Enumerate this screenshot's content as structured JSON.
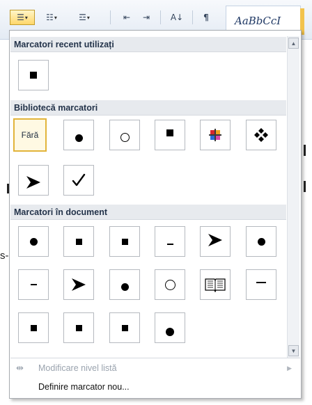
{
  "ribbon": {
    "style_preview": "AaBbCcI",
    "pilcrow": "¶",
    "sort_glyph": "A↓"
  },
  "background": {
    "hyphen_text": "s-"
  },
  "panel": {
    "recent": {
      "title": "Marcatori recent utilizați",
      "items": [
        {
          "glyph": "square"
        }
      ]
    },
    "library": {
      "title": "Bibliotecă marcatori",
      "items": [
        {
          "glyph": "none",
          "label": "Fără",
          "selected": true
        },
        {
          "glyph": "dot"
        },
        {
          "glyph": "circle"
        },
        {
          "glyph": "square"
        },
        {
          "glyph": "four-color-cross"
        },
        {
          "glyph": "four-diamonds"
        },
        {
          "glyph": "arrowhead"
        },
        {
          "glyph": "checkmark"
        }
      ]
    },
    "document": {
      "title": "Marcatori în document",
      "items": [
        {
          "glyph": "dot"
        },
        {
          "glyph": "square"
        },
        {
          "glyph": "square"
        },
        {
          "glyph": "dash"
        },
        {
          "glyph": "arrowhead"
        },
        {
          "glyph": "dot"
        },
        {
          "glyph": "dash"
        },
        {
          "glyph": "arrowhead"
        },
        {
          "glyph": "dot"
        },
        {
          "glyph": "circle"
        },
        {
          "glyph": "book"
        },
        {
          "glyph": "long-dash"
        },
        {
          "glyph": "square"
        },
        {
          "glyph": "square"
        },
        {
          "glyph": "square"
        },
        {
          "glyph": "dot"
        }
      ]
    },
    "menu": {
      "change_level": "Modificare nivel listă",
      "define_new": "Definire marcator nou..."
    }
  },
  "colors": {
    "selected_border": "#e2b43a",
    "header_bg": "#e7eaee",
    "header_text": "#23334a"
  }
}
